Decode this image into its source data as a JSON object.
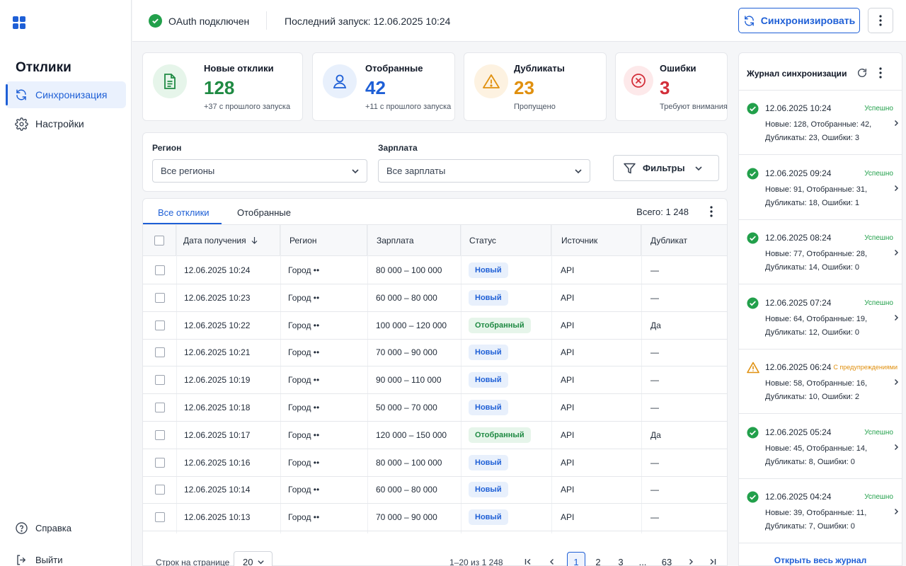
{
  "sidebar": {
    "title": "Отклики",
    "items": [
      {
        "label": "Синхронизация"
      },
      {
        "label": "Настройки"
      }
    ],
    "help_label": "Справка",
    "logout_label": "Выйти"
  },
  "header": {
    "oauth_status": "OAuth подключен",
    "last_run": "Последний запуск: 12.06.2025 10:24",
    "sync_button": "Синхронизировать"
  },
  "stats": [
    {
      "label": "Новые отклики",
      "value": "128",
      "sub": "+37 с прошлого запуска",
      "color": "#1f8a43"
    },
    {
      "label": "Отобранные",
      "value": "42",
      "sub": "+11 с прошлого запуска",
      "color": "#1e5fd6"
    },
    {
      "label": "Дубликаты",
      "value": "23",
      "sub": "Пропущено",
      "color": "#e0900f"
    },
    {
      "label": "Ошибки",
      "value": "3",
      "sub": "Требуют внимания",
      "color": "#d32f3a"
    }
  ],
  "filters": {
    "region_label": "Регион",
    "region_value": "Все регионы",
    "salary_label": "Зарплата",
    "salary_value": "Все зарплаты",
    "filters_button": "Фильтры"
  },
  "tabs": [
    {
      "label": "Все отклики"
    },
    {
      "label": "Отобранные"
    }
  ],
  "total": "Всего: 1 248",
  "table": {
    "columns": [
      "Дата получения",
      "Регион",
      "Зарплата",
      "Статус",
      "Источник",
      "Дубликат"
    ],
    "rows": [
      {
        "date": "12.06.2025 10:24",
        "region": "Город ••",
        "salary": "80 000 – 100 000",
        "status": "Новый",
        "source": "API",
        "dup": "—"
      },
      {
        "date": "12.06.2025 10:23",
        "region": "Город ••",
        "salary": "60 000 – 80 000",
        "status": "Новый",
        "source": "API",
        "dup": "—"
      },
      {
        "date": "12.06.2025 10:22",
        "region": "Город ••",
        "salary": "100 000 – 120 000",
        "status": "Отобранный",
        "source": "API",
        "dup": "Да"
      },
      {
        "date": "12.06.2025 10:21",
        "region": "Город ••",
        "salary": "70 000 – 90 000",
        "status": "Новый",
        "source": "API",
        "dup": "—"
      },
      {
        "date": "12.06.2025 10:19",
        "region": "Город ••",
        "salary": "90 000 – 110 000",
        "status": "Новый",
        "source": "API",
        "dup": "—"
      },
      {
        "date": "12.06.2025 10:18",
        "region": "Город ••",
        "salary": "50 000 – 70 000",
        "status": "Новый",
        "source": "API",
        "dup": "—"
      },
      {
        "date": "12.06.2025 10:17",
        "region": "Город ••",
        "salary": "120 000 – 150 000",
        "status": "Отобранный",
        "source": "API",
        "dup": "Да"
      },
      {
        "date": "12.06.2025 10:16",
        "region": "Город ••",
        "salary": "80 000 – 100 000",
        "status": "Новый",
        "source": "API",
        "dup": "—"
      },
      {
        "date": "12.06.2025 10:14",
        "region": "Город ••",
        "salary": "60 000 – 80 000",
        "status": "Новый",
        "source": "API",
        "dup": "—"
      },
      {
        "date": "12.06.2025 10:13",
        "region": "Город ••",
        "salary": "70 000 – 90 000",
        "status": "Новый",
        "source": "API",
        "dup": "—"
      }
    ]
  },
  "pagination": {
    "per_page_label": "Строк на странице",
    "per_page_value": "20",
    "range": "1–20 из 1 248",
    "pages": [
      "1",
      "2",
      "3",
      "...",
      "63"
    ],
    "current_page": "1"
  },
  "log": {
    "title": "Журнал синхронизации",
    "open_all": "Открыть весь журнал",
    "entries": [
      {
        "time": "12.06.2025 10:24",
        "status": "Успешно",
        "kind": "ok",
        "line1": "Новые: 128, Отобранные: 42,",
        "line2": "Дубликаты: 23, Ошибки: 3"
      },
      {
        "time": "12.06.2025 09:24",
        "status": "Успешно",
        "kind": "ok",
        "line1": "Новые: 91, Отобранные: 31,",
        "line2": "Дубликаты: 18, Ошибки: 1"
      },
      {
        "time": "12.06.2025 08:24",
        "status": "Успешно",
        "kind": "ok",
        "line1": "Новые: 77, Отобранные: 28,",
        "line2": "Дубликаты: 14, Ошибки: 0"
      },
      {
        "time": "12.06.2025 07:24",
        "status": "Успешно",
        "kind": "ok",
        "line1": "Новые: 64, Отобранные: 19,",
        "line2": "Дубликаты: 12, Ошибки: 0"
      },
      {
        "time": "12.06.2025 06:24",
        "status": "С предупреждениями",
        "kind": "warn",
        "line1": "Новые: 58, Отобранные: 16,",
        "line2": "Дубликаты: 10, Ошибки: 2"
      },
      {
        "time": "12.06.2025 05:24",
        "status": "Успешно",
        "kind": "ok",
        "line1": "Новые: 45, Отобранные: 14,",
        "line2": "Дубликаты: 8, Ошибки: 0"
      },
      {
        "time": "12.06.2025 04:24",
        "status": "Успешно",
        "kind": "ok",
        "line1": "Новые: 39, Отобранные: 11,",
        "line2": "Дубликаты: 7, Ошибки: 0"
      }
    ]
  },
  "colors": {
    "accent": "#1e5fd6",
    "success": "#22a04b",
    "warning": "#e0900f",
    "error": "#d32f3a"
  }
}
